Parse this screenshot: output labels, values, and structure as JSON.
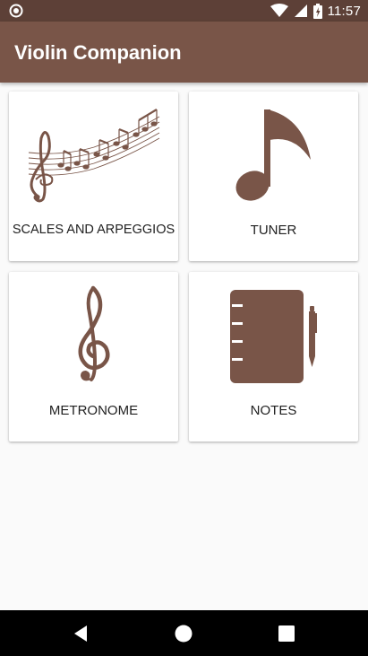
{
  "status_bar": {
    "time": "11:57",
    "icons": [
      "notification-icon",
      "wifi-icon",
      "signal-icon",
      "battery-icon"
    ]
  },
  "app_bar": {
    "title": "Violin Companion"
  },
  "menu": {
    "items": [
      {
        "label": "SCALES AND ARPEGGIOS",
        "icon": "music-staff-icon"
      },
      {
        "label": "TUNER",
        "icon": "music-note-icon"
      },
      {
        "label": "METRONOME",
        "icon": "treble-clef-icon"
      },
      {
        "label": "NOTES",
        "icon": "notebook-icon"
      }
    ]
  },
  "nav_bar": {
    "buttons": [
      "back-icon",
      "home-icon",
      "recents-icon"
    ]
  },
  "colors": {
    "primary": "#795548",
    "primary_dark": "#5d4037",
    "background": "#fafafa",
    "icon": "#795548"
  }
}
